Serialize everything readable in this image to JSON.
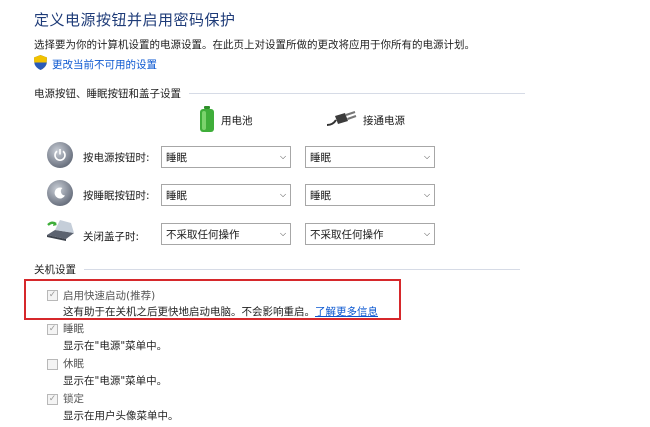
{
  "header": {
    "title": "定义电源按钮并启用密码保护",
    "description": "选择要为你的计算机设置的电源设置。在此页上对设置所做的更改将应用于你所有的电源计划。",
    "change_link": "更改当前不可用的设置"
  },
  "buttons_section": {
    "heading": "电源按钮、睡眠按钮和盖子设置",
    "col_battery": "用电池",
    "col_plugged": "接通电源",
    "rows": [
      {
        "label": "按电源按钮时:",
        "battery": "睡眠",
        "plugged": "睡眠"
      },
      {
        "label": "按睡眠按钮时:",
        "battery": "睡眠",
        "plugged": "睡眠"
      },
      {
        "label": "关闭盖子时:",
        "battery": "不采取任何操作",
        "plugged": "不采取任何操作"
      }
    ]
  },
  "shutdown_section": {
    "heading": "关机设置",
    "items": [
      {
        "label": "启用快速启动(推荐)",
        "desc": "这有助于在关机之后更快地启动电脑。不会影响重启。",
        "link": "了解更多信息",
        "checked": true
      },
      {
        "label": "睡眠",
        "desc": "显示在\"电源\"菜单中。",
        "checked": true
      },
      {
        "label": "休眠",
        "desc": "显示在\"电源\"菜单中。",
        "checked": false
      },
      {
        "label": "锁定",
        "desc": "显示在用户头像菜单中。",
        "checked": true
      }
    ]
  },
  "colors": {
    "title": "#1e3b78",
    "link": "#0b57d0",
    "highlight_box": "#d6282b",
    "battery_green": "#3fae3a"
  }
}
